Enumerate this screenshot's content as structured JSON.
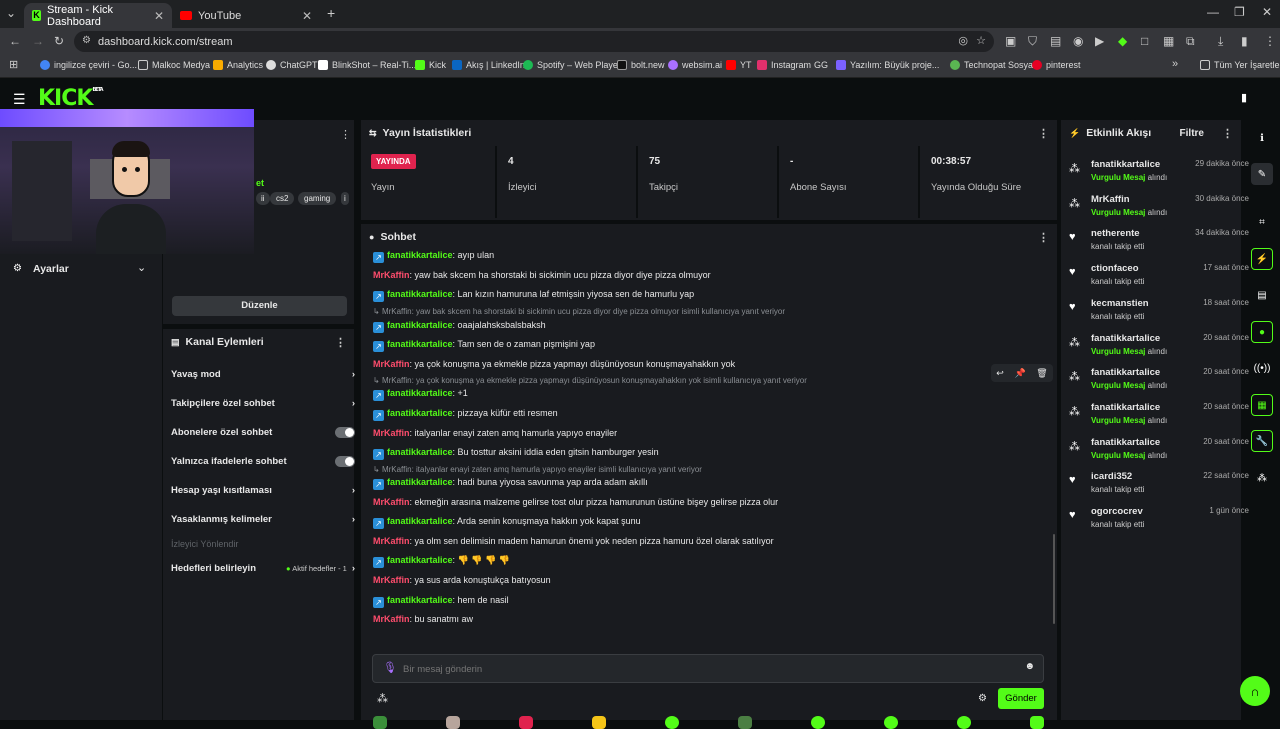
{
  "browser": {
    "tabs": [
      {
        "label": "Stream - Kick Dashboard",
        "active": true
      },
      {
        "label": "YouTube",
        "active": false
      }
    ],
    "url": "dashboard.kick.com/stream",
    "bookmarks": [
      "ingilizce çeviri - Go...",
      "Malkoc Medya",
      "Analytics",
      "ChatGPT",
      "BlinkShot – Real-Ti...",
      "Kick",
      "Akış | LinkedIn",
      "Spotify – Web Player",
      "bolt.new",
      "websim.ai",
      "YT",
      "Instagram",
      "GG",
      "Yazılım: Büyük proje...",
      "Technopat Sosyal",
      "pinterest"
    ],
    "all_bookmarks": "Tüm Yer İşaretleri"
  },
  "app": {
    "logo": "KICK",
    "logo_sup": "BETA",
    "accent": "#53fc18"
  },
  "left": {
    "tags": [
      "cs2",
      "gaming"
    ],
    "tag_partial": "et",
    "settings_label": "Ayarlar",
    "edit_button": "Düzenle",
    "actions_title": "Kanal Eylemleri",
    "actions": [
      {
        "label": "Yavaş mod",
        "kind": "chevron"
      },
      {
        "label": "Takipçilere özel sohbet",
        "kind": "chevron"
      },
      {
        "label": "Abonelere özel sohbet",
        "kind": "toggle"
      },
      {
        "label": "Yalnızca ifadelerle sohbet",
        "kind": "toggle"
      },
      {
        "label": "Hesap yaşı kısıtlaması",
        "kind": "chevron"
      },
      {
        "label": "Yasaklanmış kelimeler",
        "kind": "chevron"
      }
    ],
    "viewer_redirect": "İzleyici Yönlendir",
    "goals_label": "Hedefleri belirleyin",
    "goals_status": "Aktif hedefler - 1"
  },
  "stats": {
    "title": "Yayın İstatistikleri",
    "live_badge": "YAYINDA",
    "items": [
      {
        "value": "",
        "label": "Yayın"
      },
      {
        "value": "4",
        "label": "İzleyici"
      },
      {
        "value": "75",
        "label": "Takipçi"
      },
      {
        "value": "-",
        "label": "Abone Sayısı"
      },
      {
        "value": "00:38:57",
        "label": "Yayında Olduğu Süre"
      }
    ]
  },
  "chat": {
    "title": "Sohbet",
    "messages": [
      {
        "type": "msg",
        "user": "fanatikkartalice",
        "text": ": ayıp ulan"
      },
      {
        "type": "msg",
        "user": "MrKaffin",
        "text": ": yaw bak skcem ha shorstaki bi sickimin ucu pizza diyor diye pizza olmuyor"
      },
      {
        "type": "msg",
        "user": "fanatikkartalice",
        "text": ": Lan kızın hamuruna laf etmişsin yiyosa sen de hamurlu yap"
      },
      {
        "type": "reply",
        "text": "MrKaffin: yaw bak skcem ha shorstaki bi sickimin ucu pizza diyor diye pizza olmuyor isimli kullanıcıya yanıt veriyor"
      },
      {
        "type": "msg",
        "user": "fanatikkartalice",
        "text": ": oaajalahsksbalsbaksh"
      },
      {
        "type": "msg",
        "user": "fanatikkartalice",
        "text": ": Tam sen de o zaman pişmişini yap"
      },
      {
        "type": "msg",
        "user": "MrKaffin",
        "text": ": ya çok konuşma ya ekmekle pizza yapmayı düşünüyosun konuşmayahakkın yok"
      },
      {
        "type": "reply",
        "text": "MrKaffin: ya çok konuşma ya ekmekle pizza yapmayı düşünüyosun konuşmayahakkın yok isimli kullanıcıya yanıt veriyor"
      },
      {
        "type": "msg",
        "user": "fanatikkartalice",
        "text": ": +1"
      },
      {
        "type": "msg",
        "user": "fanatikkartalice",
        "text": ": pizzaya küfür etti resmen"
      },
      {
        "type": "msg",
        "user": "MrKaffin",
        "text": ": italyanlar enayi zaten amq hamurla yapıyo enayiler"
      },
      {
        "type": "msg",
        "user": "fanatikkartalice",
        "text": ": Bu tosttur aksini iddia eden gitsin hamburger yesin"
      },
      {
        "type": "reply",
        "text": "MrKaffin: italyanlar enayi zaten amq hamurla yapıyo enayiler isimli kullanıcıya yanıt veriyor"
      },
      {
        "type": "msg",
        "user": "fanatikkartalice",
        "text": ": hadi buna yiyosa savunma yap arda adam akıllı"
      },
      {
        "type": "msg",
        "user": "MrKaffin",
        "text": ": ekmeğin arasına malzeme gelirse tost olur pizza hamurunun üstüne bişey gelirse pizza olur"
      },
      {
        "type": "msg",
        "user": "fanatikkartalice",
        "text": ": Arda senin konuşmaya hakkın yok kapat şunu"
      },
      {
        "type": "msg",
        "user": "MrKaffin",
        "text": ": ya olm sen delimisin madem hamurun önemi yok neden pizza hamuru özel olarak satılıyor"
      },
      {
        "type": "msg",
        "user": "fanatikkartalice",
        "text": ": 👎 👎 👎 👎"
      },
      {
        "type": "msg",
        "user": "MrKaffin",
        "text": ": ya sus arda konuştukça batıyosun"
      },
      {
        "type": "msg",
        "user": "fanatikkartalice",
        "text": ": hem de nasil"
      },
      {
        "type": "msg",
        "user": "MrKaffin",
        "text": ": bu sanatmı aw"
      }
    ],
    "input_placeholder": "Bir mesaj gönderin",
    "send_button": "Gönder"
  },
  "activity": {
    "title": "Etkinlik Akışı",
    "filter": "Filtre",
    "items": [
      {
        "user": "fanatikkartalice",
        "action_highlight": "Vurgulu Mesaj",
        "action": "alındı",
        "time": "29 dakika önce",
        "icon": "bubbles-icon"
      },
      {
        "user": "MrKaffin",
        "action_highlight": "Vurgulu Mesaj",
        "action": "alındı",
        "time": "30 dakika önce",
        "icon": "bubbles-icon"
      },
      {
        "user": "netherente",
        "action_highlight": "",
        "action": "kanalı takip etti",
        "time": "34 dakika önce",
        "icon": "heart-icon"
      },
      {
        "user": "ctionfaceo",
        "action_highlight": "",
        "action": "kanalı takip etti",
        "time": "17 saat önce",
        "icon": "heart-icon"
      },
      {
        "user": "kecmanstien",
        "action_highlight": "",
        "action": "kanalı takip etti",
        "time": "18 saat önce",
        "icon": "heart-icon"
      },
      {
        "user": "fanatikkartalice",
        "action_highlight": "Vurgulu Mesaj",
        "action": "alındı",
        "time": "20 saat önce",
        "icon": "bubbles-icon"
      },
      {
        "user": "fanatikkartalice",
        "action_highlight": "Vurgulu Mesaj",
        "action": "alındı",
        "time": "20 saat önce",
        "icon": "bubbles-icon"
      },
      {
        "user": "fanatikkartalice",
        "action_highlight": "Vurgulu Mesaj",
        "action": "alındı",
        "time": "20 saat önce",
        "icon": "bubbles-icon"
      },
      {
        "user": "fanatikkartalice",
        "action_highlight": "Vurgulu Mesaj",
        "action": "alındı",
        "time": "20 saat önce",
        "icon": "bubbles-icon"
      },
      {
        "user": "icardi352",
        "action_highlight": "",
        "action": "kanalı takip etti",
        "time": "22 saat önce",
        "icon": "heart-icon"
      },
      {
        "user": "ogorcocrev",
        "action_highlight": "",
        "action": "kanalı takip etti",
        "time": "1 gün önce",
        "icon": "heart-icon"
      }
    ]
  }
}
